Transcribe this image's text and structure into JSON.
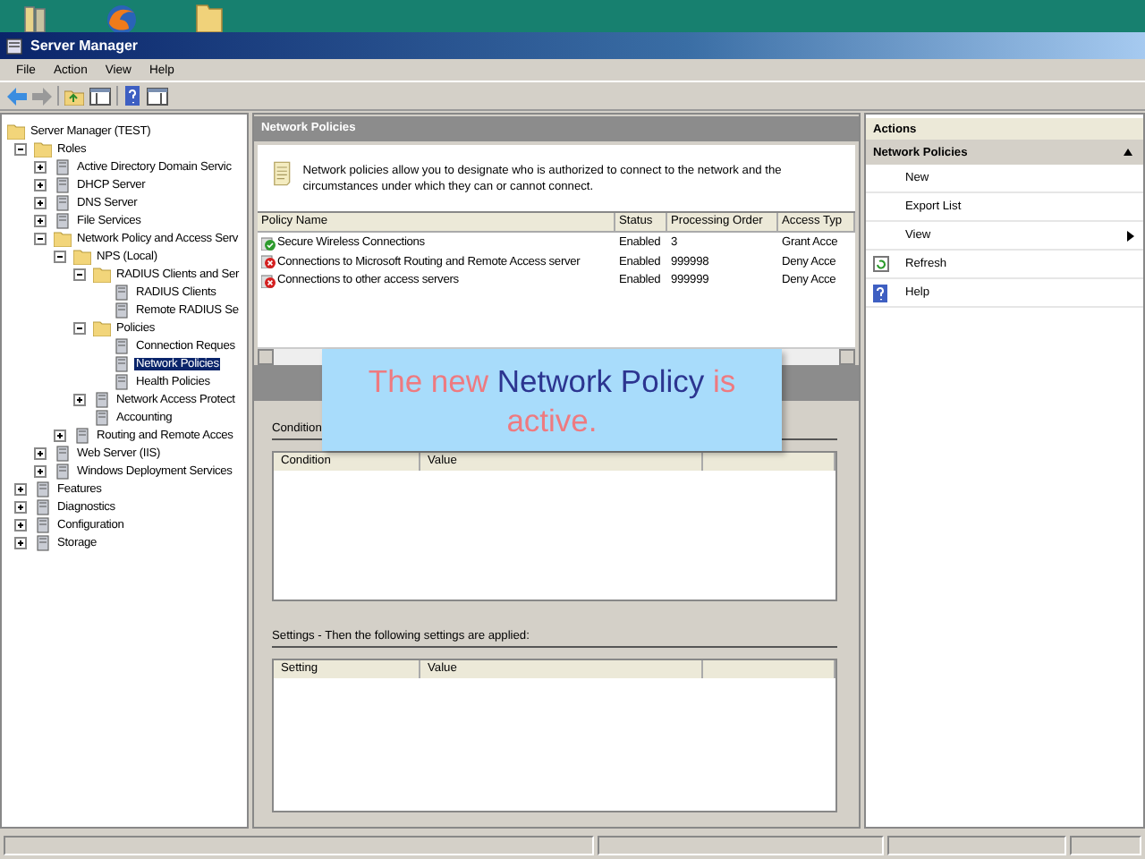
{
  "window": {
    "title": "Server Manager"
  },
  "menu": [
    "File",
    "Action",
    "View",
    "Help"
  ],
  "tree": {
    "label": "Server Manager (TEST)",
    "selected": false,
    "children": [
      {
        "label": "Roles",
        "expanded": true,
        "selected": false,
        "children": [
          {
            "label": "Active Directory Domain Servic",
            "expanded": false,
            "selected": false
          },
          {
            "label": "DHCP Server",
            "expanded": false,
            "selected": false
          },
          {
            "label": "DNS Server",
            "expanded": false,
            "selected": false
          },
          {
            "label": "File Services",
            "expanded": false,
            "selected": false
          },
          {
            "label": "Network Policy and Access Serv",
            "expanded": true,
            "selected": false,
            "children": [
              {
                "label": "NPS (Local)",
                "expanded": true,
                "selected": false,
                "children": [
                  {
                    "label": "RADIUS Clients and Ser",
                    "expanded": true,
                    "selected": false,
                    "children": [
                      {
                        "label": "RADIUS Clients",
                        "selected": false
                      },
                      {
                        "label": "Remote RADIUS Se",
                        "selected": false
                      }
                    ]
                  },
                  {
                    "label": "Policies",
                    "expanded": true,
                    "selected": false,
                    "children": [
                      {
                        "label": "Connection Reques",
                        "selected": false
                      },
                      {
                        "label": "Network Policies",
                        "selected": true
                      },
                      {
                        "label": "Health Policies",
                        "selected": false
                      }
                    ]
                  },
                  {
                    "label": "Network Access Protect",
                    "expanded": false,
                    "selected": false
                  },
                  {
                    "label": "Accounting",
                    "selected": false
                  }
                ]
              },
              {
                "label": "Routing and Remote Acces",
                "expanded": false,
                "selected": false
              }
            ]
          },
          {
            "label": "Web Server (IIS)",
            "expanded": false,
            "selected": false
          },
          {
            "label": "Windows Deployment Services",
            "expanded": false,
            "selected": false
          }
        ]
      },
      {
        "label": "Features",
        "expanded": false,
        "selected": false
      },
      {
        "label": "Diagnostics",
        "expanded": false,
        "selected": false
      },
      {
        "label": "Configuration",
        "expanded": false,
        "selected": false
      },
      {
        "label": "Storage",
        "expanded": false,
        "selected": false
      }
    ]
  },
  "center": {
    "title": "Network Policies",
    "description": "Network policies allow you to designate who is authorized to connect to the network and the circumstances under which they can or cannot connect.",
    "columns": [
      "Policy Name",
      "Status",
      "Processing Order",
      "Access Typ"
    ],
    "rows": [
      {
        "kind": "grant",
        "cells": [
          "Secure Wireless Connections",
          "Enabled",
          "3",
          "Grant Acce"
        ]
      },
      {
        "kind": "deny",
        "cells": [
          "Connections to Microsoft Routing and Remote Access server",
          "Enabled",
          "999998",
          "Deny Acce"
        ]
      },
      {
        "kind": "deny",
        "cells": [
          "Connections to other access servers",
          "Enabled",
          "999999",
          "Deny Acce"
        ]
      }
    ],
    "conditions_tab": "Condition",
    "conditions_columns": [
      "Condition",
      "Value"
    ],
    "settings_label": "Settings - Then the following settings are applied:",
    "settings_columns": [
      "Setting",
      "Value"
    ]
  },
  "actions": {
    "title": "Actions",
    "section": "Network Policies",
    "items": [
      {
        "kind": "plain",
        "label": "New"
      },
      {
        "kind": "plain",
        "label": "Export List"
      },
      {
        "kind": "submenu",
        "label": "View"
      },
      {
        "kind": "refresh",
        "label": "Refresh"
      },
      {
        "kind": "help",
        "label": "Help"
      }
    ]
  },
  "callout": "The new **Network Policy** is active."
}
